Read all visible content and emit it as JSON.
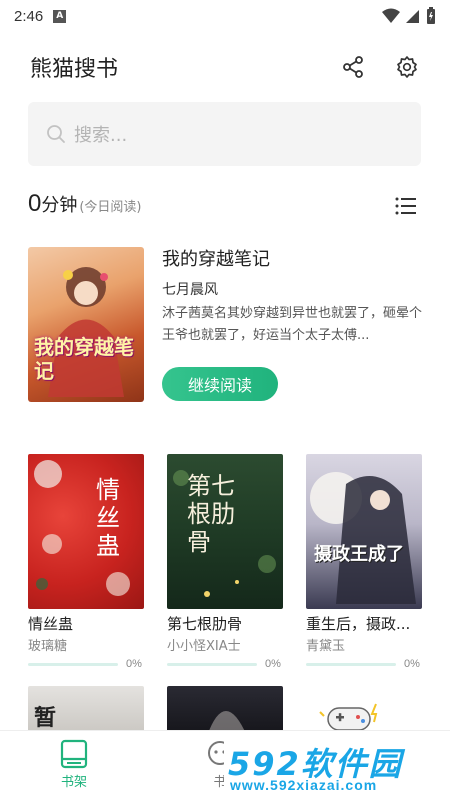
{
  "status": {
    "time": "2:46",
    "a_badge": "A"
  },
  "header": {
    "title": "熊猫搜书"
  },
  "search": {
    "placeholder": "搜索..."
  },
  "reading": {
    "minutes": "0",
    "unit": "分钟",
    "note": "(今日阅读)"
  },
  "current_book": {
    "title": "我的穿越笔记",
    "author": "七月晨风",
    "description": "沐子茜莫名其妙穿越到异世也就罢了，砸晕个王爷也就罢了，好运当个太子太傅...",
    "continue_label": "继续阅读",
    "cover_text": "我的穿越笔记"
  },
  "shelf": [
    {
      "name": "情丝蛊",
      "author": "玻璃糖",
      "progress": 0,
      "progress_label": "0%",
      "cover_text": "情丝蛊",
      "cover_bg": "#c8231f"
    },
    {
      "name": "第七根肋骨",
      "author": "小小怪XIA士",
      "progress": 0,
      "progress_label": "0%",
      "cover_text": "第七根肋骨",
      "cover_bg": "#1f3b25"
    },
    {
      "name": "重生后，摄政...",
      "author": "青黛玉",
      "progress": 0,
      "progress_label": "0%",
      "cover_text": "摄政王成了",
      "cover_bg": "#e8e6ef"
    }
  ],
  "row2": [
    {
      "cover_text": "暂",
      "cover_bg": "#d7d5d2"
    },
    {
      "cover_text": "",
      "cover_bg": "#1c1c22"
    },
    {
      "cover_text": "",
      "cover_bg": "#ffffff"
    }
  ],
  "nav": [
    {
      "label": "书架",
      "active": true
    },
    {
      "label": "书",
      "active": false
    }
  ],
  "watermark": {
    "big": "592软件园",
    "url": "www.592xiazai.com"
  },
  "colors": {
    "accent": "#20b37d",
    "accent_light": "#35c48e",
    "watermark": "#1aa6e6"
  }
}
